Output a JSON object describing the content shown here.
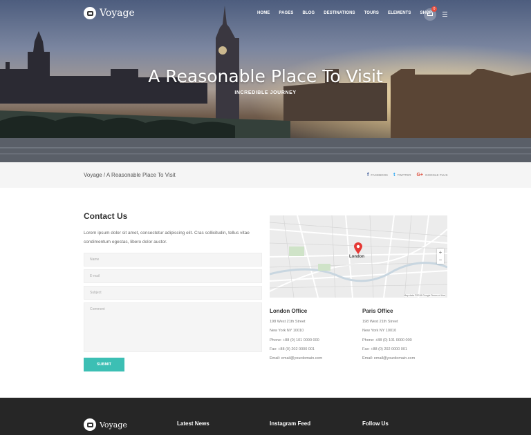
{
  "nav": {
    "logo_text": "Voyage",
    "menu": [
      "HOME",
      "PAGES",
      "BLOG",
      "DESTINATIONS",
      "TOURS",
      "ELEMENTS",
      "SHOP"
    ],
    "cart_count": "0"
  },
  "hero": {
    "title": "A Reasonable Place To Visit",
    "subtitle": "INCREDIBLE JOURNEY"
  },
  "breadcrumb": {
    "text": "Voyage / A Reasonable Place To Visit"
  },
  "share": [
    {
      "icon": "f",
      "label": "FACEBOOK",
      "color": "#3b5998"
    },
    {
      "icon": "t",
      "label": "TWITTER",
      "color": "#1da1f2"
    },
    {
      "icon": "G+",
      "label": "GOOGLE PLUS",
      "color": "#dd4b39"
    }
  ],
  "contact": {
    "title": "Contact Us",
    "text": "Lorem ipsum dolor sit amet, consectetur adipiscing elit. Cras sollicitudin, tellus vitae condimentum egestas, libero dolor auctor.",
    "fields": {
      "name": "Name",
      "email": "E-mail",
      "subject": "Subject",
      "comment": "Comment"
    },
    "submit": "SUBMIT"
  },
  "map": {
    "city": "London",
    "attribution": "Map data ©2018 Google   Terms of Use"
  },
  "offices": [
    {
      "title": "London Office",
      "lines": [
        "198 West 21th Street",
        "New York NY 10010",
        "Phone: +88 (0) 101 0000 000",
        "Fax: +88 (0) 202 0000 001",
        "Email: email@yourdomain.com"
      ]
    },
    {
      "title": "Paris Office",
      "lines": [
        "198 West 21th Street",
        "New York NY 10010",
        "Phone: +88 (0) 101 0000 000",
        "Fax: +88 (0) 202 0000 001",
        "Email: email@yourdomain.com"
      ]
    }
  ],
  "footer": {
    "logo_text": "Voyage",
    "headings": [
      "Latest News",
      "Instagram Feed",
      "Follow Us"
    ]
  },
  "colors": {
    "accent": "#3cbfb4",
    "footer_bg": "#262626",
    "map_pin": "#e53935"
  }
}
